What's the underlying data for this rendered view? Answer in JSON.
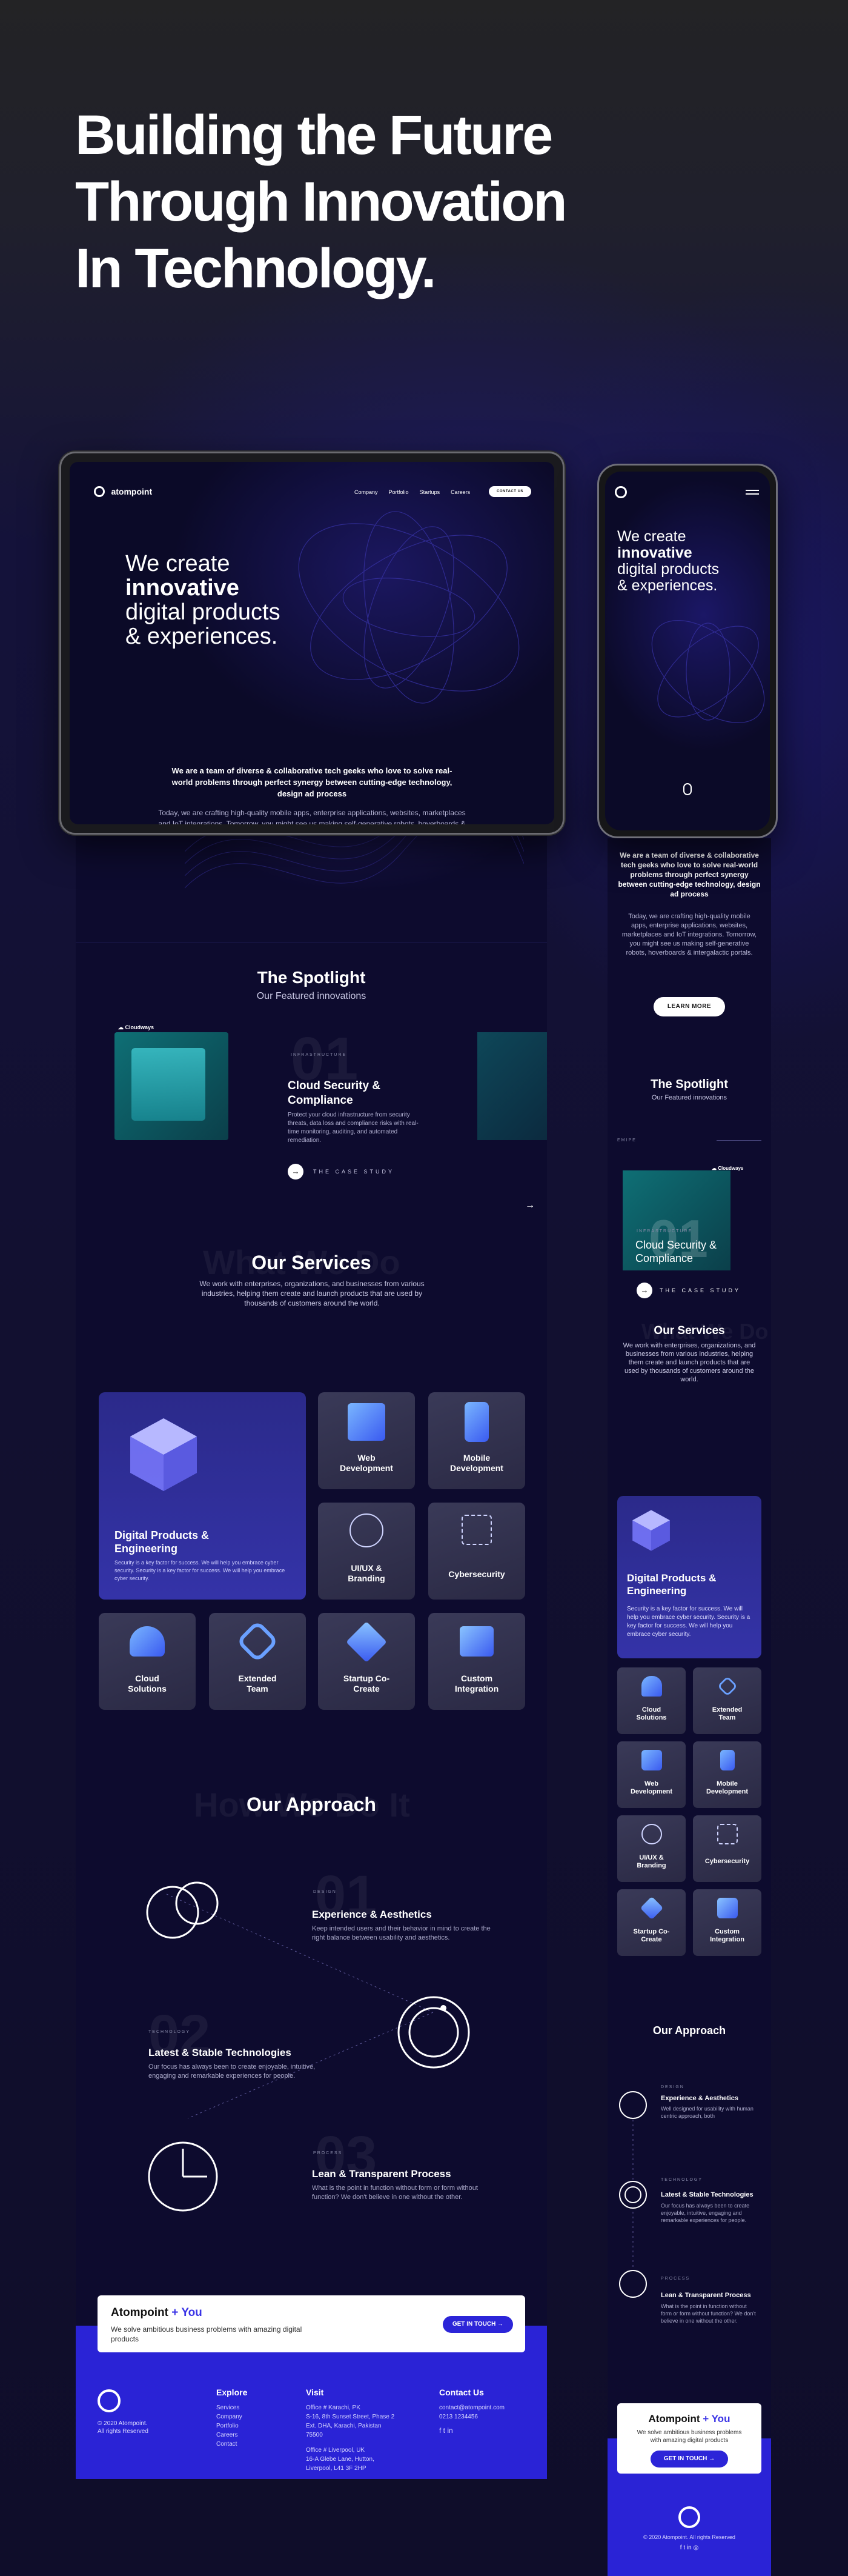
{
  "hero": {
    "title_line1": "Building the Future",
    "title_line2": "Through Innovation",
    "title_line3": "In Technology."
  },
  "nav": {
    "logo": "atompoint",
    "items": [
      "Company",
      "Portfolio",
      "Startups",
      "Careers"
    ],
    "cta": "CONTACT US"
  },
  "intro": {
    "line1": "We create",
    "line2": "innovative",
    "line3": "digital products",
    "line4": "& experiences.",
    "bold": "We are a team of diverse & collaborative tech geeks who love to solve real-world problems through perfect synergy between cutting-edge technology, design ad process",
    "body": "Today, we are crafting high-quality mobile apps, enterprise applications, websites, marketplaces and IoT integrations. Tomorrow, you might see us making self-generative robots, hoverboards & intergalactic portals.",
    "button": "LEARN MORE"
  },
  "spotlight": {
    "title": "The Spotlight",
    "subtitle": "Our Featured innovations",
    "brand": "Cloudways",
    "number": "01",
    "eyebrow": "INFRASTRUCTURE",
    "case_title": "Cloud Security & Compliance",
    "case_desc": "Protect your cloud infrastructure from security threats, data loss and compliance risks with real-time monitoring, auditing, and automated remediation.",
    "case_link": "THE CASE STUDY",
    "arrow": "→",
    "mobile_eyebrow": "EMIPE"
  },
  "services": {
    "ghost": "What We Do",
    "title": "Our Services",
    "desc": "We work with enterprises, organizations, and businesses from various industries, helping them create and launch products that are used by thousands of customers around the world.",
    "featured_title": "Digital Products & Engineering",
    "featured_desc": "Security is a key factor for success. We will help you embrace cyber security. Security is a key factor for success. We will help you embrace cyber security.",
    "items": [
      {
        "label": "Web Development"
      },
      {
        "label": "Mobile Development"
      },
      {
        "label": "UI/UX & Branding"
      },
      {
        "label": "Cybersecurity"
      },
      {
        "label": "Cloud Solutions"
      },
      {
        "label": "Extended Team"
      },
      {
        "label": "Startup Co-Create"
      },
      {
        "label": "Custom Integration"
      }
    ]
  },
  "approach": {
    "ghost": "How We Do It",
    "title": "Our Approach",
    "steps": [
      {
        "num": "01",
        "eyebrow": "DESIGN",
        "title": "Experience & Aesthetics",
        "desc": "Keep intended users and their behavior in mind to create the right balance between usability and aesthetics."
      },
      {
        "num": "02",
        "eyebrow": "TECHNOLOGY",
        "title": "Latest & Stable Technologies",
        "desc": "Our focus has always been to create enjoyable, intuitive, engaging and remarkable experiences for people."
      },
      {
        "num": "03",
        "eyebrow": "PROCESS",
        "title": "Lean & Transparent Process",
        "desc": "What is the point in function without form or form without function? We don't believe in one without the other."
      }
    ],
    "mobile_step1_desc": "Well designed for usability with human centric approach, both"
  },
  "cta": {
    "brand": "Atompoint",
    "plus": "+",
    "you": "You",
    "desc": "We solve ambitious business problems with amazing digital products",
    "button": "GET IN TOUCH",
    "arrow": "→"
  },
  "footer": {
    "copyright": "© 2020 Atompoint.",
    "rights": "All rights Reserved",
    "explore_title": "Explore",
    "explore": [
      "Services",
      "Company",
      "Portfolio",
      "Careers",
      "Contact"
    ],
    "visit_title": "Visit",
    "visit_1": "Office # Karachi, PK\nS-16, 8th Sunset Street, Phase 2\nExt. DHA, Karachi, Pakistan\n75500",
    "visit_2": "Office # Liverpool, UK\n16-A Glebe Lane, Hutton,\nLiverpool, L41 3F 2HP",
    "contact_title": "Contact Us",
    "email": "contact@atompoint.com",
    "phone": "0213 1234456",
    "social": "f  t  in",
    "mobile_copy": "© 2020 Atompoint. All rights Reserved",
    "mobile_social": "f  t  in  ◎"
  }
}
